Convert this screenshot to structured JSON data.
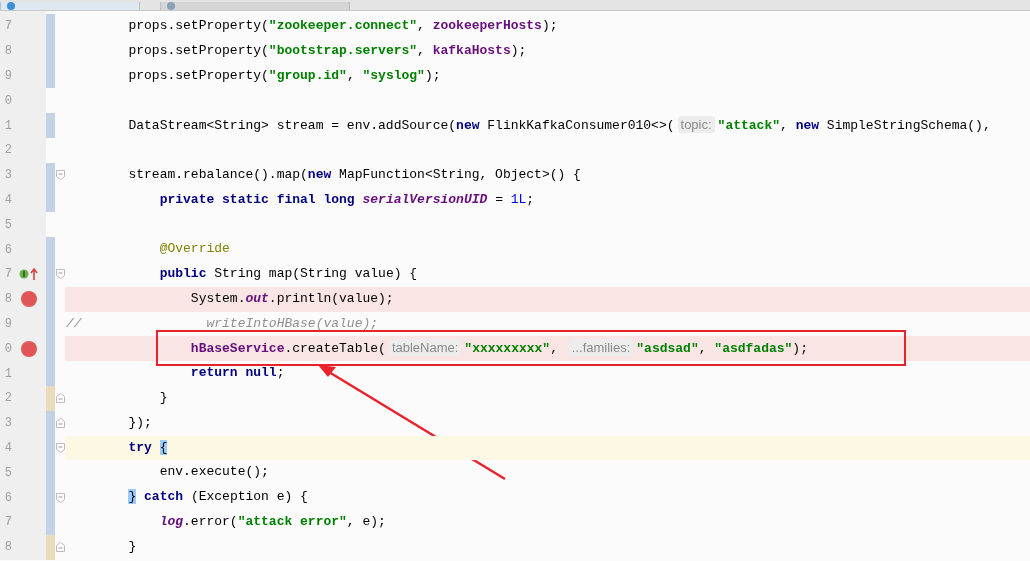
{
  "tabs": [
    {
      "selected": true
    },
    {
      "selected": false
    }
  ],
  "lines": [
    {
      "number": "7",
      "modified": true,
      "added": false,
      "fold_start": false,
      "fold_end": false,
      "breakpoint": false,
      "implements": false,
      "caret": false,
      "boxed": false,
      "tokens": [
        {
          "kind": "p",
          "text": "        props.setProperty("
        },
        {
          "kind": "s",
          "text": "\"zookeeper.connect\""
        },
        {
          "kind": "p",
          "text": ", "
        },
        {
          "kind": "f",
          "text": "zookeeperHosts"
        },
        {
          "kind": "p",
          "text": ");"
        }
      ]
    },
    {
      "number": "8",
      "modified": true,
      "added": false,
      "fold_start": false,
      "fold_end": false,
      "breakpoint": false,
      "implements": false,
      "caret": false,
      "boxed": false,
      "tokens": [
        {
          "kind": "p",
          "text": "        props.setProperty("
        },
        {
          "kind": "s",
          "text": "\"bootstrap.servers\""
        },
        {
          "kind": "p",
          "text": ", "
        },
        {
          "kind": "f",
          "text": "kafkaHosts"
        },
        {
          "kind": "p",
          "text": ");"
        }
      ]
    },
    {
      "number": "9",
      "modified": true,
      "added": false,
      "fold_start": false,
      "fold_end": false,
      "breakpoint": false,
      "implements": false,
      "caret": false,
      "boxed": false,
      "tokens": [
        {
          "kind": "p",
          "text": "        props.setProperty("
        },
        {
          "kind": "s",
          "text": "\"group.id\""
        },
        {
          "kind": "p",
          "text": ", "
        },
        {
          "kind": "s",
          "text": "\"syslog\""
        },
        {
          "kind": "p",
          "text": ");"
        }
      ]
    },
    {
      "number": "0",
      "modified": false,
      "added": false,
      "fold_start": false,
      "fold_end": false,
      "breakpoint": false,
      "implements": false,
      "caret": false,
      "boxed": false
    },
    {
      "number": "1",
      "modified": true,
      "added": false,
      "fold_start": false,
      "fold_end": false,
      "breakpoint": false,
      "implements": false,
      "caret": false,
      "boxed": false,
      "tokens": [
        {
          "kind": "p",
          "text": "        DataStream<String> stream = env.addSource("
        },
        {
          "kind": "k",
          "text": "new"
        },
        {
          "kind": "p",
          "text": " FlinkKafkaConsumer010<>("
        },
        {
          "kind": "h",
          "text": "topic:"
        },
        {
          "kind": "s",
          "text": "\"attack\""
        },
        {
          "kind": "p",
          "text": ", "
        },
        {
          "kind": "k",
          "text": "new"
        },
        {
          "kind": "p",
          "text": " SimpleStringSchema(),"
        }
      ]
    },
    {
      "number": "2",
      "modified": false,
      "added": false,
      "fold_start": false,
      "fold_end": false,
      "breakpoint": false,
      "implements": false,
      "caret": false,
      "boxed": false
    },
    {
      "number": "3",
      "modified": true,
      "added": false,
      "fold_start": true,
      "fold_end": false,
      "breakpoint": false,
      "implements": false,
      "caret": false,
      "boxed": false,
      "tokens": [
        {
          "kind": "p",
          "text": "        stream.rebalance().map("
        },
        {
          "kind": "k",
          "text": "new"
        },
        {
          "kind": "p",
          "text": " MapFunction<String, Object>() {"
        }
      ]
    },
    {
      "number": "4",
      "modified": true,
      "added": false,
      "fold_start": false,
      "fold_end": false,
      "breakpoint": false,
      "implements": false,
      "caret": false,
      "boxed": false,
      "tokens": [
        {
          "kind": "k",
          "text": "            private static final long"
        },
        {
          "kind": "fi",
          "text": " serialVersionUID"
        },
        {
          "kind": "p",
          "text": " = "
        },
        {
          "kind": "n",
          "text": "1L"
        },
        {
          "kind": "p",
          "text": ";"
        }
      ]
    },
    {
      "number": "5",
      "modified": false,
      "added": false,
      "fold_start": false,
      "fold_end": false,
      "breakpoint": false,
      "implements": false,
      "caret": false,
      "boxed": false
    },
    {
      "number": "6",
      "modified": true,
      "added": false,
      "fold_start": false,
      "fold_end": false,
      "breakpoint": false,
      "implements": false,
      "caret": false,
      "boxed": false,
      "tokens": [
        {
          "kind": "a",
          "text": "            @Override"
        }
      ]
    },
    {
      "number": "7",
      "modified": true,
      "added": false,
      "fold_start": true,
      "fold_end": false,
      "breakpoint": false,
      "implements": true,
      "caret": false,
      "boxed": false,
      "tokens": [
        {
          "kind": "k",
          "text": "            public"
        },
        {
          "kind": "p",
          "text": " String map(String value) {"
        }
      ]
    },
    {
      "number": "8",
      "modified": true,
      "added": false,
      "fold_start": false,
      "fold_end": false,
      "breakpoint": true,
      "implements": false,
      "caret": false,
      "boxed": false,
      "tokens": [
        {
          "kind": "p",
          "text": "                System."
        },
        {
          "kind": "fi",
          "text": "out"
        },
        {
          "kind": "p",
          "text": ".println(value);"
        }
      ]
    },
    {
      "number": "9",
      "modified": true,
      "added": false,
      "fold_start": false,
      "fold_end": false,
      "breakpoint": false,
      "implements": false,
      "caret": false,
      "boxed": false,
      "tokens": [
        {
          "kind": "c",
          "text": "//                writeIntoHBase(value);"
        }
      ]
    },
    {
      "number": "0",
      "modified": true,
      "added": false,
      "fold_start": false,
      "fold_end": false,
      "breakpoint": true,
      "implements": false,
      "caret": false,
      "boxed": true,
      "tokens": [
        {
          "kind": "f",
          "text": "                hBaseService"
        },
        {
          "kind": "p",
          "text": ".createTable("
        },
        {
          "kind": "h",
          "text": "tableName:"
        },
        {
          "kind": "s",
          "text": "\"xxxxxxxxx\""
        },
        {
          "kind": "p",
          "text": ", "
        },
        {
          "kind": "h",
          "text": "...families:"
        },
        {
          "kind": "s",
          "text": "\"asdsad\""
        },
        {
          "kind": "p",
          "text": ", "
        },
        {
          "kind": "s",
          "text": "\"asdfadas\""
        },
        {
          "kind": "p",
          "text": ");"
        }
      ]
    },
    {
      "number": "1",
      "modified": true,
      "added": false,
      "fold_start": false,
      "fold_end": false,
      "breakpoint": false,
      "implements": false,
      "caret": false,
      "boxed": false,
      "tokens": [
        {
          "kind": "k",
          "text": "                return null"
        },
        {
          "kind": "p",
          "text": ";"
        }
      ]
    },
    {
      "number": "2",
      "modified": false,
      "added": true,
      "fold_start": false,
      "fold_end": true,
      "breakpoint": false,
      "implements": false,
      "caret": false,
      "boxed": false,
      "tokens": [
        {
          "kind": "p",
          "text": "            }"
        }
      ]
    },
    {
      "number": "3",
      "modified": true,
      "added": false,
      "fold_start": false,
      "fold_end": true,
      "breakpoint": false,
      "implements": false,
      "caret": false,
      "boxed": false,
      "tokens": [
        {
          "kind": "p",
          "text": "        });"
        }
      ]
    },
    {
      "number": "4",
      "modified": true,
      "added": false,
      "fold_start": true,
      "fold_end": false,
      "breakpoint": false,
      "implements": false,
      "caret": true,
      "boxed": false,
      "tokens": [
        {
          "kind": "k",
          "text": "        try"
        },
        {
          "kind": "m",
          "text": " {"
        }
      ]
    },
    {
      "number": "5",
      "modified": true,
      "added": false,
      "fold_start": false,
      "fold_end": false,
      "breakpoint": false,
      "implements": false,
      "caret": false,
      "boxed": false,
      "tokens": [
        {
          "kind": "p",
          "text": "            env.execute();"
        }
      ]
    },
    {
      "number": "6",
      "modified": true,
      "added": false,
      "fold_start": true,
      "fold_end": false,
      "breakpoint": false,
      "implements": false,
      "caret": false,
      "boxed": false,
      "tokens": [
        {
          "kind": "m",
          "text": "        }"
        },
        {
          "kind": "k",
          "text": " catch"
        },
        {
          "kind": "p",
          "text": " (Exception e) {"
        }
      ]
    },
    {
      "number": "7",
      "modified": true,
      "added": false,
      "fold_start": false,
      "fold_end": false,
      "breakpoint": false,
      "implements": false,
      "caret": false,
      "boxed": false,
      "tokens": [
        {
          "kind": "fi",
          "text": "            log"
        },
        {
          "kind": "p",
          "text": ".error("
        },
        {
          "kind": "s",
          "text": "\"attack error\""
        },
        {
          "kind": "p",
          "text": ", e);"
        }
      ]
    },
    {
      "number": "8",
      "modified": false,
      "added": true,
      "fold_start": false,
      "fold_end": true,
      "breakpoint": false,
      "implements": false,
      "caret": false,
      "boxed": false,
      "tokens": [
        {
          "kind": "p",
          "text": "        }"
        }
      ]
    }
  ]
}
